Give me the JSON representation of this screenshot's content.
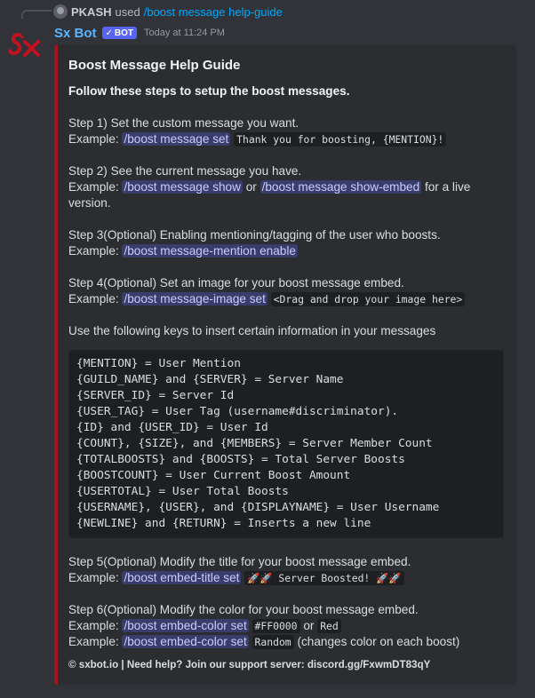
{
  "reply": {
    "username": "PKASH",
    "used_text": "used",
    "command": "/boost message help-guide"
  },
  "message": {
    "username": "Sx Bot",
    "bot_tag": "BOT",
    "timestamp": "Today at 11:24 PM"
  },
  "embed": {
    "color": "#a3141c",
    "title": "Boost Message Help Guide",
    "intro": "Follow these steps to setup the boost messages.",
    "example_label": "Example:",
    "step1": {
      "text": "Step 1) Set the custom message you want.",
      "cmd": "/boost message set",
      "code": "Thank you for boosting, {MENTION}!"
    },
    "step2": {
      "text": "Step 2) See the current message you have.",
      "cmd1": "/boost message show",
      "or": "or",
      "cmd2": "/boost message show-embed",
      "suffix": "for a live version."
    },
    "step3": {
      "text": "Step 3(Optional) Enabling mentioning/tagging of the user who boosts.",
      "cmd": "/boost message-mention enable"
    },
    "step4": {
      "text": "Step 4(Optional) Set an image for your boost message embed.",
      "cmd": "/boost message-image set",
      "code": "<Drag and drop your image here>"
    },
    "keys_intro": "Use the following keys to insert certain information in your messages",
    "keys": [
      "{MENTION} = User Mention",
      "{GUILD_NAME} and {SERVER} = Server Name",
      "{SERVER_ID} = Server Id",
      "{USER_TAG} = User Tag (username#discriminator).",
      "{ID} and {USER_ID} = User Id",
      "{COUNT}, {SIZE}, and {MEMBERS} = Server Member Count",
      "{TOTALBOOSTS} and {BOOSTS} = Total Server Boosts",
      "{BOOSTCOUNT} = User Current Boost Amount",
      "{USERTOTAL} = User Total Boosts",
      "{USERNAME}, {USER}, and {DISPLAYNAME} = User Username",
      "{NEWLINE} and {RETURN} = Inserts a new line"
    ],
    "step5": {
      "text": "Step 5(Optional) Modify the title for your boost message embed.",
      "cmd": "/boost embed-title set",
      "code": "🚀🚀 Server Boosted! 🚀🚀"
    },
    "step6": {
      "text": "Step 6(Optional) Modify the color for your boost message embed.",
      "cmd": "/boost embed-color set",
      "code1": "#FF0000",
      "or": "or",
      "code2": "Red",
      "code3": "Random",
      "suffix": "(changes color on each boost)"
    },
    "footer": "© sxbot.io | Need help? Join our support server: discord.gg/FxwmDT83qY"
  }
}
